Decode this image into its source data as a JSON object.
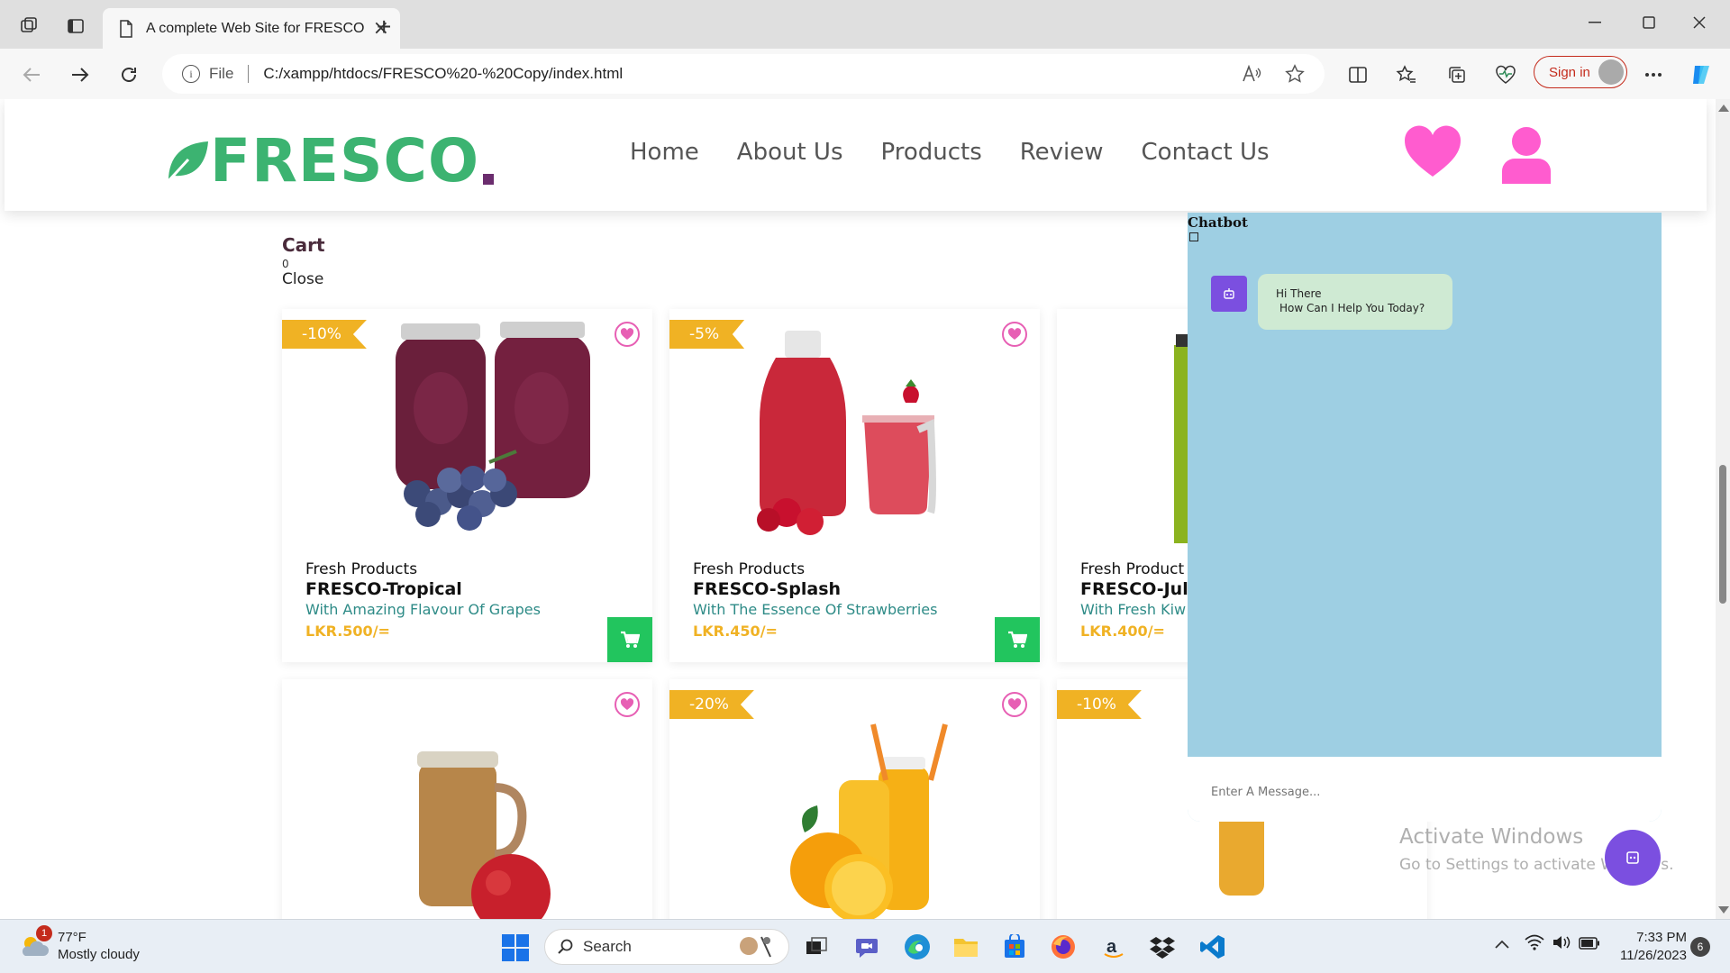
{
  "browser": {
    "tab_title": "A complete Web Site for FRESCO",
    "url_scheme_label": "File",
    "url": "C:/xampp/htdocs/FRESCO%20-%20Copy/index.html",
    "signin_label": "Sign in"
  },
  "site": {
    "logo_text": "FRESCO",
    "nav": [
      "Home",
      "About Us",
      "Products",
      "Review",
      "Contact Us"
    ],
    "colors": {
      "brand_green": "#3cb371",
      "accent_pink": "#e75fb4",
      "badge_orange": "#f0b224",
      "cart_green": "#22c55e"
    }
  },
  "cart": {
    "title": "Cart",
    "count": "0",
    "close_label": "Close"
  },
  "products": [
    {
      "badge": "-10%",
      "subtitle": "Fresh Products",
      "name": "FRESCO-Tropical",
      "desc": "With Amazing Flavour Of Grapes",
      "price": "LKR.500/="
    },
    {
      "badge": "-5%",
      "subtitle": "Fresh Products",
      "name": "FRESCO-Splash",
      "desc": "With The Essence Of Strawberries",
      "price": "LKR.450/="
    },
    {
      "badge": "",
      "subtitle": "Fresh Product",
      "name": "FRESCO-Jul",
      "desc": "With Fresh Kiw",
      "price": "LKR.400/="
    },
    {
      "badge": "",
      "subtitle": "",
      "name": "",
      "desc": "",
      "price": ""
    },
    {
      "badge": "-20%",
      "subtitle": "",
      "name": "",
      "desc": "",
      "price": ""
    },
    {
      "badge": "-10%",
      "subtitle": "",
      "name": "",
      "desc": "",
      "price": ""
    }
  ],
  "chatbot": {
    "title": "Chatbot",
    "greeting_line1": "Hi There",
    "greeting_line2": "How Can I Help You Today?",
    "input_placeholder": "Enter A Message..."
  },
  "watermark": {
    "line1": "Activate Windows",
    "line2": "Go to Settings to activate Windows."
  },
  "taskbar": {
    "weather_temp": "77°F",
    "weather_desc": "Mostly cloudy",
    "weather_badge": "1",
    "search_label": "Search",
    "time": "7:33 PM",
    "date": "11/26/2023",
    "notification_count": "6"
  }
}
